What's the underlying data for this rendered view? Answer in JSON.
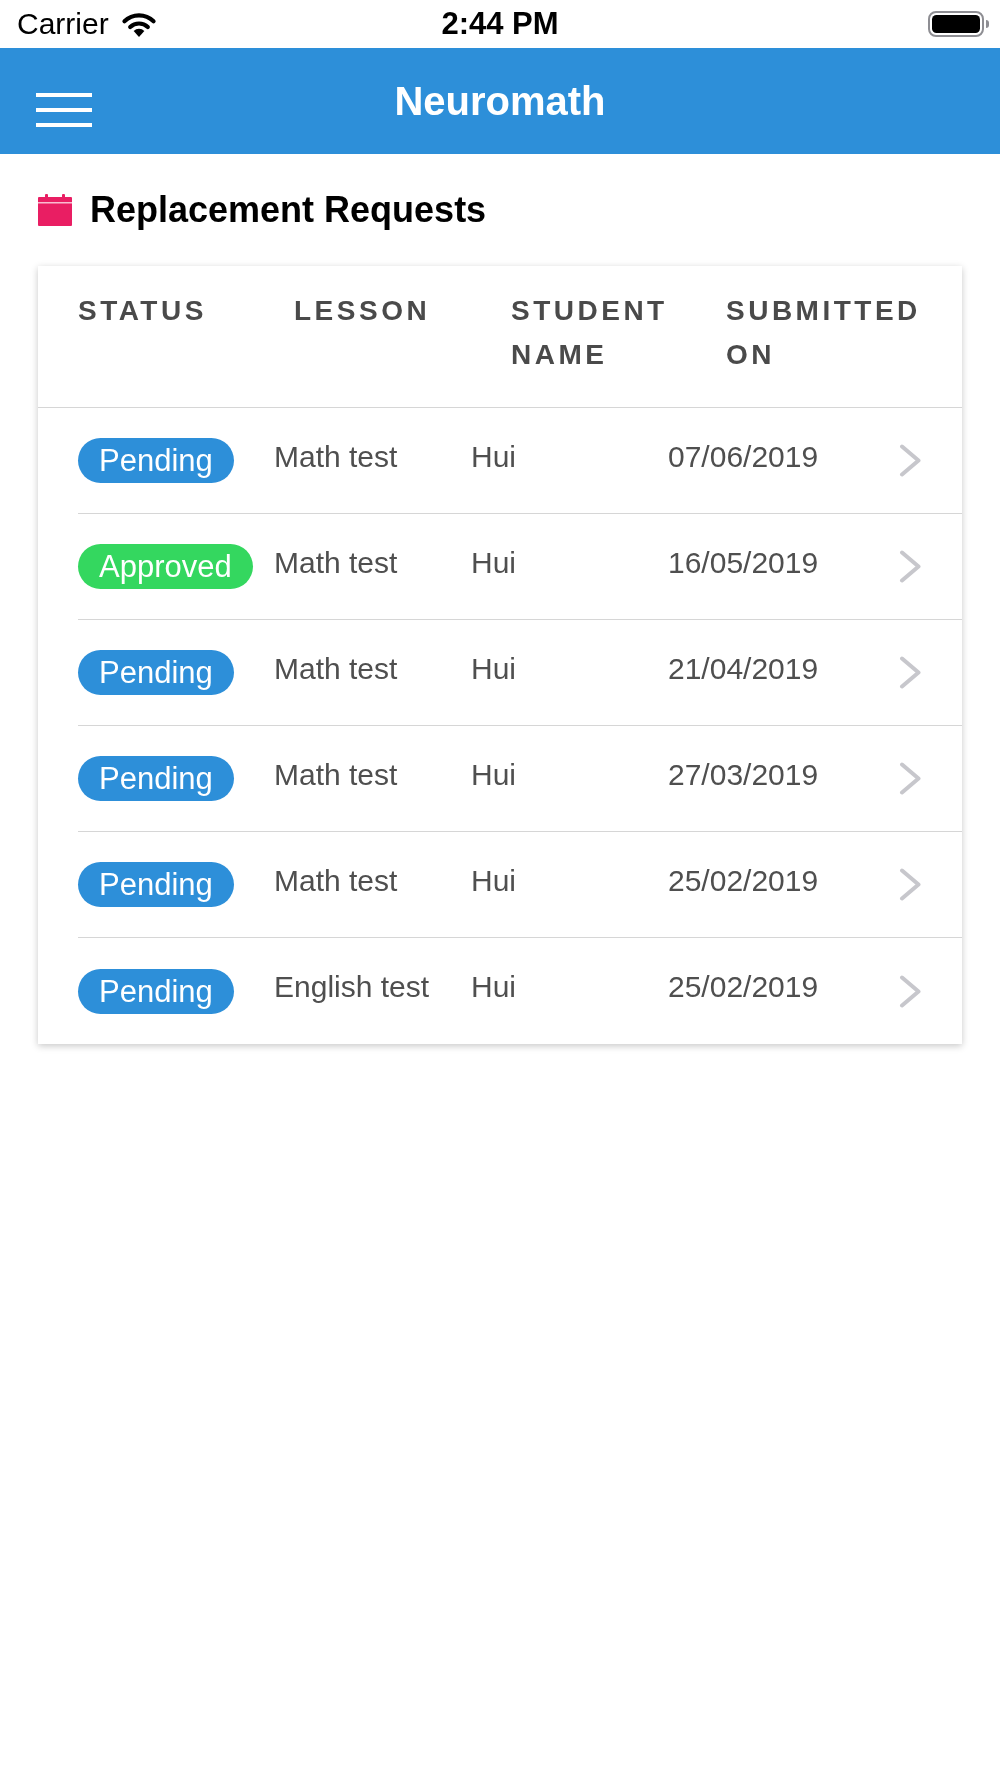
{
  "status_bar": {
    "carrier": "Carrier",
    "time": "2:44 PM"
  },
  "app_bar": {
    "title": "Neuromath"
  },
  "section": {
    "title": "Replacement Requests"
  },
  "table": {
    "columns": [
      "STATUS",
      "LESSON",
      "STUDENT NAME",
      "SUBMITTED ON"
    ],
    "rows": [
      {
        "status": {
          "label": "Pending",
          "color": "#2d8fd9"
        },
        "lesson": "Math test",
        "student_name": "Hui",
        "submitted_on": "07/06/2019"
      },
      {
        "status": {
          "label": "Approved",
          "color": "#34d75f"
        },
        "lesson": "Math test",
        "student_name": "Hui",
        "submitted_on": "16/05/2019"
      },
      {
        "status": {
          "label": "Pending",
          "color": "#2d8fd9"
        },
        "lesson": "Math test",
        "student_name": "Hui",
        "submitted_on": "21/04/2019"
      },
      {
        "status": {
          "label": "Pending",
          "color": "#2d8fd9"
        },
        "lesson": "Math test",
        "student_name": "Hui",
        "submitted_on": "27/03/2019"
      },
      {
        "status": {
          "label": "Pending",
          "color": "#2d8fd9"
        },
        "lesson": "Math test",
        "student_name": "Hui",
        "submitted_on": "25/02/2019"
      },
      {
        "status": {
          "label": "Pending",
          "color": "#2d8fd9"
        },
        "lesson": "English test",
        "student_name": "Hui",
        "submitted_on": "25/02/2019"
      }
    ]
  }
}
